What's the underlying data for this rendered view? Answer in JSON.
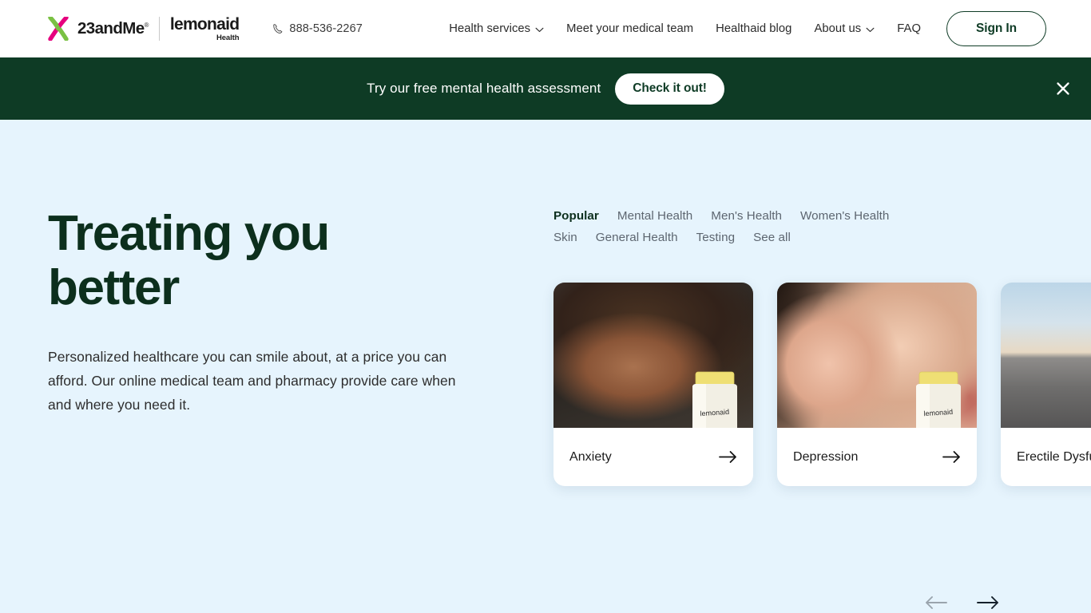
{
  "header": {
    "brand": {
      "primary": "23andMe",
      "registered": "®",
      "secondary": "lemonaid",
      "secondary_sub": "Health",
      "logo_icon": "chromosome-x-logo",
      "logo_green": "#7ac143",
      "logo_pink": "#e6007e"
    },
    "phone": {
      "icon": "phone-icon",
      "number": "888-536-2267"
    },
    "nav": [
      {
        "label": "Health services",
        "has_dropdown": true,
        "icon": "chevron-down-icon"
      },
      {
        "label": "Meet your medical team",
        "has_dropdown": false
      },
      {
        "label": "Healthaid blog",
        "has_dropdown": false
      },
      {
        "label": "About us",
        "has_dropdown": true,
        "icon": "chevron-down-icon"
      },
      {
        "label": "FAQ",
        "has_dropdown": false
      }
    ],
    "sign_in": "Sign In"
  },
  "promo": {
    "text": "Try our free mental health assessment",
    "cta": "Check it out!",
    "close_icon": "close-icon",
    "bg_color": "#0e3b25"
  },
  "hero": {
    "title": "Treating you better",
    "subtitle": "Personalized healthcare you can smile about, at a price you can afford. Our online medical team and pharmacy provide care when and where you need it.",
    "bg_color": "#e6f4fd",
    "title_color": "#0c2f1d"
  },
  "categories": [
    {
      "label": "Popular",
      "active": true
    },
    {
      "label": "Mental Health",
      "active": false
    },
    {
      "label": "Men's Health",
      "active": false
    },
    {
      "label": "Women's Health",
      "active": false
    },
    {
      "label": "Skin",
      "active": false
    },
    {
      "label": "General Health",
      "active": false
    },
    {
      "label": "Testing",
      "active": false
    },
    {
      "label": "See all",
      "active": false
    }
  ],
  "cards": [
    {
      "label": "Anxiety",
      "image_desc": "woman-with-closed-eyes-photo",
      "has_bottle": true,
      "bottle_brand": "lemonaid",
      "arrow_icon": "arrow-right-icon"
    },
    {
      "label": "Depression",
      "image_desc": "woman-hand-on-face-photo",
      "has_bottle": true,
      "bottle_brand": "lemonaid",
      "arrow_icon": "arrow-right-icon"
    },
    {
      "label": "Erectile Dysfunction",
      "image_desc": "man-running-outdoors-photo",
      "has_bottle": false,
      "bottle_brand": "",
      "arrow_icon": "arrow-right-icon"
    }
  ],
  "carousel_nav": {
    "prev_icon": "arrow-left-icon",
    "next_icon": "arrow-right-icon",
    "prev_disabled": true,
    "next_disabled": false
  }
}
